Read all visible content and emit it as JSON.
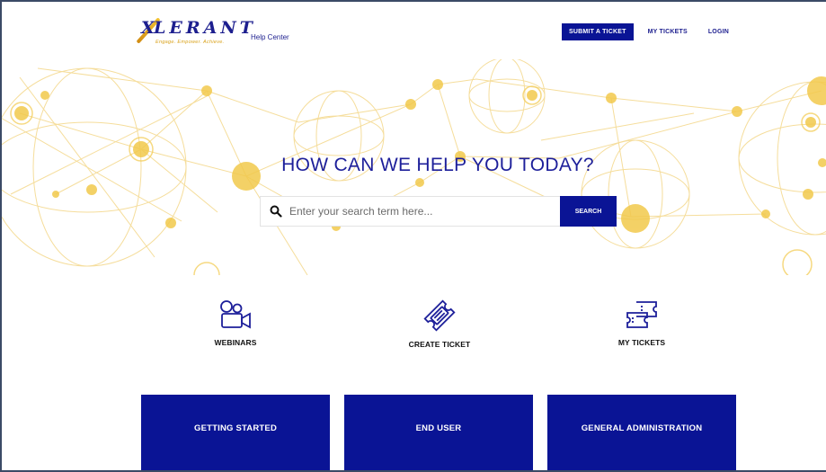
{
  "header": {
    "logo_text": "LERANT",
    "logo_x": "X",
    "logo_tagline": "Engage. Empower. Achieve.",
    "help_center": "Help Center",
    "nav": {
      "submit_ticket": "SUBMIT A TICKET",
      "my_tickets": "MY TICKETS",
      "login": "LOGIN"
    }
  },
  "hero": {
    "title": "HOW CAN WE HELP YOU TODAY?",
    "search_placeholder": "Enter your search term here...",
    "search_button": "SEARCH"
  },
  "quick_links": [
    {
      "label": "WEBINARS",
      "icon": "video-camera-icon"
    },
    {
      "label": "CREATE TICKET",
      "icon": "ticket-icon"
    },
    {
      "label": "MY TICKETS",
      "icon": "tickets-icon"
    }
  ],
  "categories": [
    {
      "label": "GETTING STARTED"
    },
    {
      "label": "END USER"
    },
    {
      "label": "GENERAL ADMINISTRATION"
    }
  ],
  "colors": {
    "primary": "#0a1495",
    "accent": "#f2c94c",
    "logo_gold": "#d9a21b"
  }
}
